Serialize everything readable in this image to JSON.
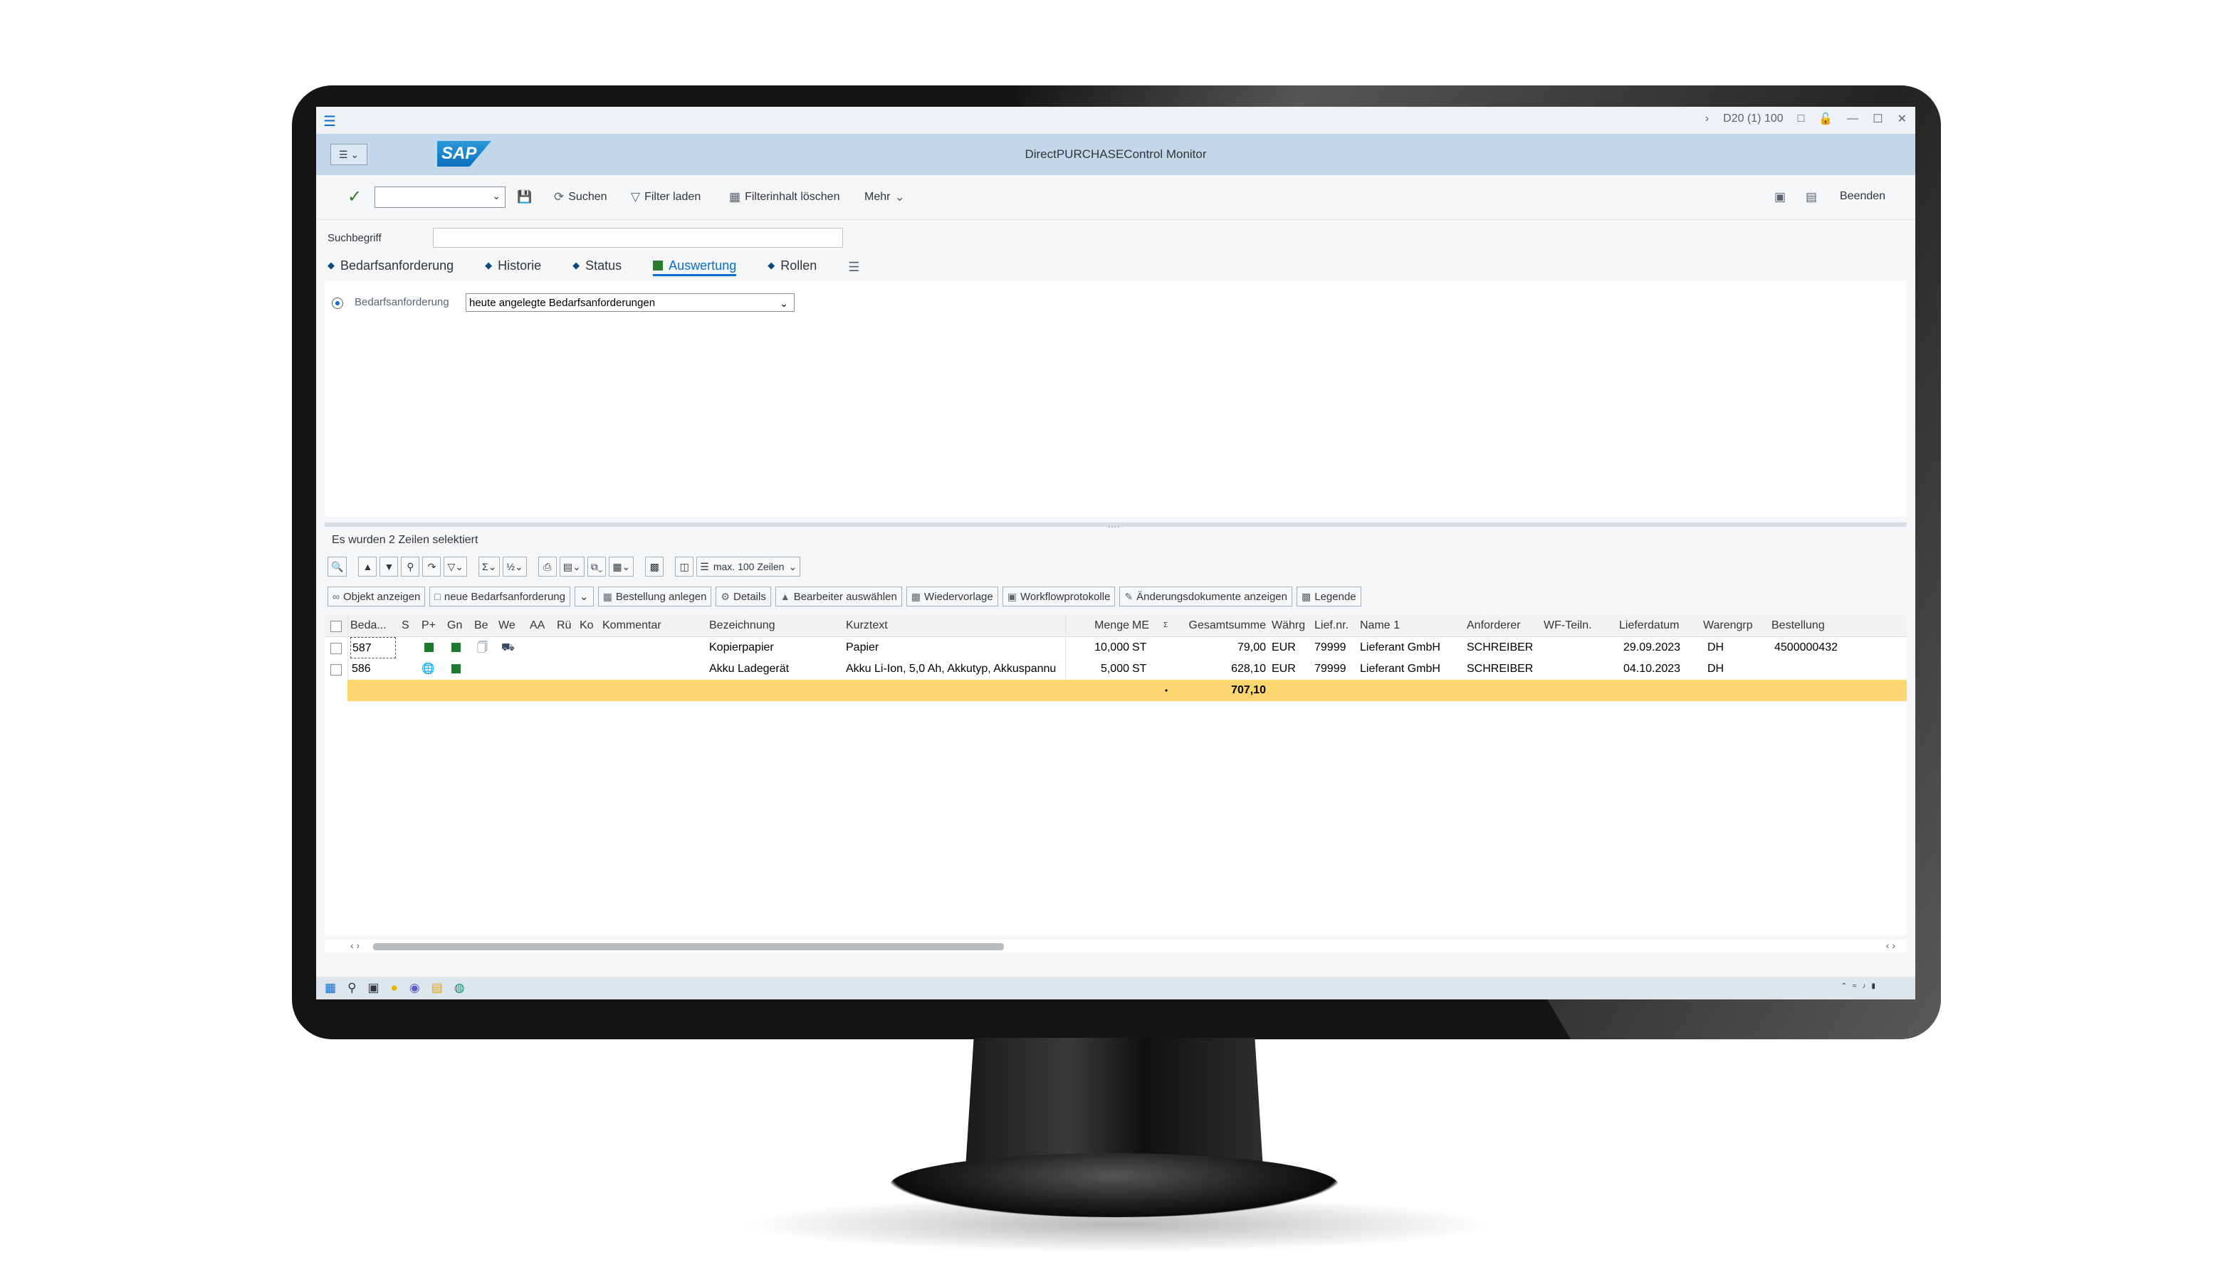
{
  "window": {
    "system_label": "D20 (1) 100",
    "title": "DirectPURCHASEControl Monitor",
    "logo_text": "SAP"
  },
  "toolbar": {
    "suchen": "Suchen",
    "filter_laden": "Filter laden",
    "filterinhalt_loeschen": "Filterinhalt löschen",
    "mehr": "Mehr",
    "beenden": "Beenden"
  },
  "search": {
    "label": "Suchbegriff",
    "value": ""
  },
  "tabs": [
    {
      "label": "Bedarfsanforderung"
    },
    {
      "label": "Historie"
    },
    {
      "label": "Status"
    },
    {
      "label": "Auswertung"
    },
    {
      "label": "Rollen"
    }
  ],
  "panel": {
    "field_label": "Bedarfsanforderung",
    "field_value": "heute angelegte Bedarfsanforderungen"
  },
  "status_message": "Es wurden 2 Zeilen selektiert",
  "alv_toolbar": {
    "max_rows": "max. 100 Zeilen"
  },
  "actions": [
    {
      "label": "Objekt anzeigen"
    },
    {
      "label": "neue Bedarfsanforderung"
    },
    {
      "label": "Bestellung anlegen"
    },
    {
      "label": "Details"
    },
    {
      "label": "Bearbeiter auswählen"
    },
    {
      "label": "Wiedervorlage"
    },
    {
      "label": "Workflowprotokolle"
    },
    {
      "label": "Änderungsdokumente anzeigen"
    },
    {
      "label": "Legende"
    }
  ],
  "table": {
    "headers": {
      "beda": "Beda...",
      "s": "S",
      "p": "P+",
      "gn": "Gn",
      "be": "Be",
      "we": "We",
      "aa": "AA",
      "ru": "Rü",
      "ko": "Ko",
      "kommentar": "Kommentar",
      "bezeichnung": "Bezeichnung",
      "kurztext": "Kurztext",
      "menge": "Menge",
      "me": "ME",
      "gesamtsumme": "Gesamtsumme",
      "waehrg": "Währg",
      "liefnr": "Lief.nr.",
      "name1": "Name 1",
      "anforderer": "Anforderer",
      "wfteiln": "WF-Teiln.",
      "lieferdatum": "Lieferdatum",
      "warengrp": "Warengrp",
      "bestellung": "Bestellung"
    },
    "rows": [
      {
        "beda": "587",
        "bezeichnung": "Kopierpapier",
        "kurztext": "Papier",
        "menge": "10,000",
        "me": "ST",
        "gesamtsumme": "79,00",
        "waehrg": "EUR",
        "liefnr": "79999",
        "name1": "Lieferant GmbH",
        "anforderer": "SCHREIBER",
        "lieferdatum": "29.09.2023",
        "warengrp": "DH",
        "bestellung": "4500000432"
      },
      {
        "beda": "586",
        "bezeichnung": "Akku Ladegerät",
        "kurztext": "Akku Li-Ion, 5,0 Ah, Akkutyp, Akkuspannu",
        "menge": "5,000",
        "me": "ST",
        "gesamtsumme": "628,10",
        "waehrg": "EUR",
        "liefnr": "79999",
        "name1": "Lieferant GmbH",
        "anforderer": "SCHREIBER",
        "lieferdatum": "04.10.2023",
        "warengrp": "DH",
        "bestellung": ""
      }
    ],
    "total": "707,10"
  },
  "colors": {
    "header_bar": "#c2d7ea",
    "total_row": "#fcd770",
    "status_green": "#1f7a31",
    "accent": "#0a6ed1"
  }
}
